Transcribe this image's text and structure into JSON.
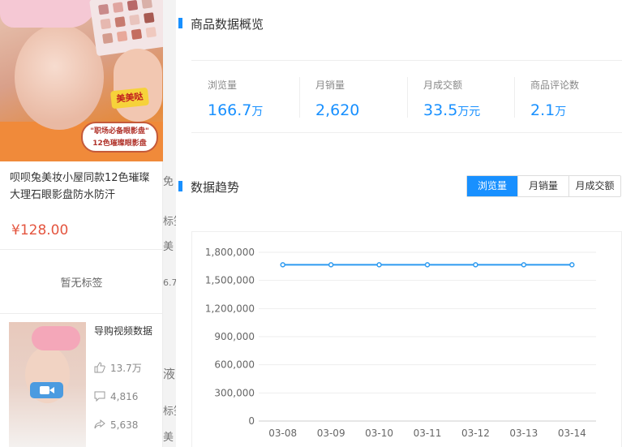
{
  "under": {
    "fragments": [
      "免",
      "标签",
      "美",
      "6.7",
      "液",
      "标签",
      "美"
    ]
  },
  "product": {
    "brand_tag": "美美哒",
    "ad_tag_line1": "\"职场必备眼影盘\"",
    "ad_tag_line2": "12色璀璨眼影盘",
    "title": "呗呗兔美妆小屋同款12色璀璨大理石眼影盘防水防汗",
    "price": "¥128.00",
    "no_tag": "暂无标签"
  },
  "video": {
    "label": "导购视频数据",
    "likes": "13.7万",
    "comments": "4,816",
    "shares": "5,638"
  },
  "overview": {
    "title": "商品数据概览",
    "metrics": [
      {
        "label": "浏览量",
        "value": "166.7",
        "unit": "万"
      },
      {
        "label": "月销量",
        "value": "2,620",
        "unit": ""
      },
      {
        "label": "月成交额",
        "value": "33.5",
        "unit": "万元"
      },
      {
        "label": "商品评论数",
        "value": "2.1",
        "unit": "万"
      }
    ]
  },
  "trend": {
    "title": "数据趋势",
    "tabs": [
      "浏览量",
      "月销量",
      "月成交额"
    ],
    "active_tab": 0
  },
  "colors": {
    "accent": "#1890ff",
    "price": "#e4553f",
    "line": "#2e9bf0"
  },
  "chart_data": {
    "type": "line",
    "x": [
      "03-08",
      "03-09",
      "03-10",
      "03-11",
      "03-12",
      "03-13",
      "03-14"
    ],
    "series": [
      {
        "values": [
          1667000,
          1667000,
          1667000,
          1667000,
          1667000,
          1667000,
          1667000
        ]
      }
    ],
    "y_ticks": [
      "1,800,000",
      "1,500,000",
      "1,200,000",
      "900,000",
      "600,000",
      "300,000",
      "0"
    ],
    "ylim": [
      0,
      1800000
    ],
    "grid": true
  }
}
